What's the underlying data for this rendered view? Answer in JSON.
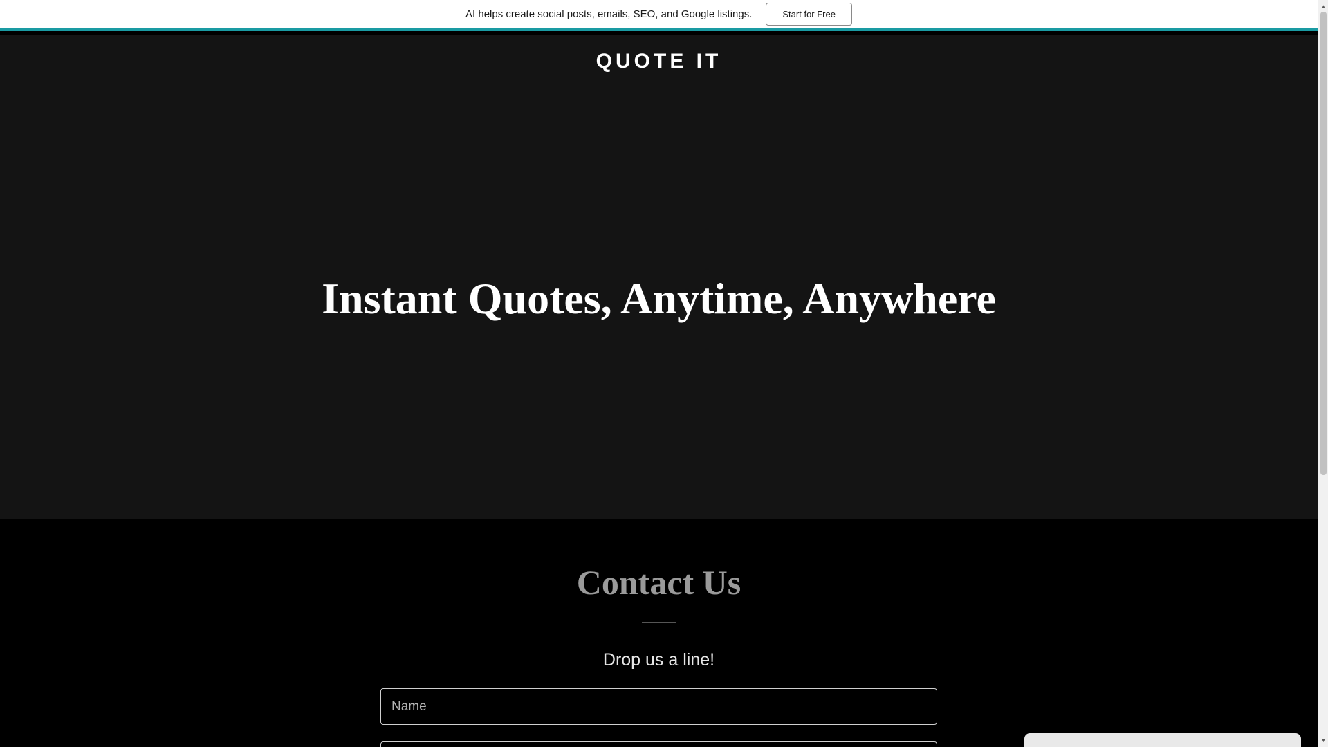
{
  "promo": {
    "text": "AI helps create social posts, emails, SEO, and Google listings.",
    "button_label": "Start for Free"
  },
  "header": {
    "brand": "QUOTE IT"
  },
  "hero": {
    "title": "Instant Quotes, Anytime, Anywhere"
  },
  "contact": {
    "title": "Contact Us",
    "subtitle": "Drop us a line!",
    "name_placeholder": "Name",
    "email_placeholder": ""
  },
  "colors": {
    "accent": "#1a9ba3",
    "hero_bg": "#141414",
    "page_bg": "#000000"
  },
  "icons": {
    "scroll_up": "triangle-up-icon",
    "scroll_down": "triangle-down-icon"
  }
}
